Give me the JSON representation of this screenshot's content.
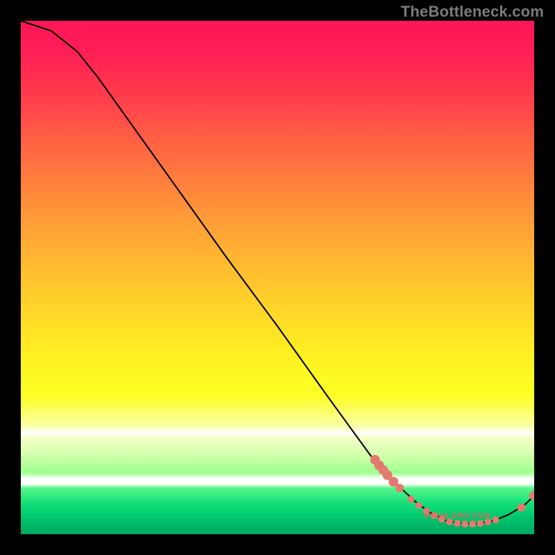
{
  "watermark": "TheBottleneck.com",
  "inline_label": "NVIDIA GRID K520",
  "colors": {
    "marker": "#e37a6f",
    "curve": "#000000",
    "gradient_top": "#ff1657",
    "gradient_mid": "#fff021",
    "gradient_bottom": "#00a85f"
  },
  "chart_data": {
    "type": "line",
    "title": "",
    "xlabel": "",
    "ylabel": "",
    "xlim": [
      0,
      100
    ],
    "ylim": [
      0,
      100
    ],
    "curve": [
      {
        "x": 0,
        "y": 100
      },
      {
        "x": 6,
        "y": 98
      },
      {
        "x": 11,
        "y": 94
      },
      {
        "x": 15,
        "y": 89
      },
      {
        "x": 20,
        "y": 82
      },
      {
        "x": 30,
        "y": 68
      },
      {
        "x": 40,
        "y": 54
      },
      {
        "x": 50,
        "y": 40.5
      },
      {
        "x": 60,
        "y": 26.5
      },
      {
        "x": 68,
        "y": 15.5
      },
      {
        "x": 71,
        "y": 12
      },
      {
        "x": 74,
        "y": 9
      },
      {
        "x": 77,
        "y": 6.2
      },
      {
        "x": 80,
        "y": 4
      },
      {
        "x": 83,
        "y": 2.6
      },
      {
        "x": 86,
        "y": 2.1
      },
      {
        "x": 89,
        "y": 2.1
      },
      {
        "x": 92,
        "y": 2.6
      },
      {
        "x": 95,
        "y": 3.8
      },
      {
        "x": 98,
        "y": 5.6
      },
      {
        "x": 100,
        "y": 7.5
      }
    ],
    "markers": [
      {
        "x": 69.0,
        "y": 14.5,
        "r": 7
      },
      {
        "x": 69.8,
        "y": 13.4,
        "r": 7
      },
      {
        "x": 70.6,
        "y": 12.5,
        "r": 7
      },
      {
        "x": 71.4,
        "y": 11.5,
        "r": 7
      },
      {
        "x": 72.6,
        "y": 10.2,
        "r": 7
      },
      {
        "x": 73.8,
        "y": 9.0,
        "r": 6
      },
      {
        "x": 76.0,
        "y": 6.8,
        "r": 5
      },
      {
        "x": 77.5,
        "y": 5.6,
        "r": 5
      },
      {
        "x": 79.0,
        "y": 4.5,
        "r": 5
      },
      {
        "x": 80.5,
        "y": 3.6,
        "r": 5
      },
      {
        "x": 82.0,
        "y": 2.9,
        "r": 5
      },
      {
        "x": 83.5,
        "y": 2.4,
        "r": 5
      },
      {
        "x": 85.0,
        "y": 2.1,
        "r": 5
      },
      {
        "x": 86.5,
        "y": 2.0,
        "r": 5
      },
      {
        "x": 88.0,
        "y": 2.0,
        "r": 5
      },
      {
        "x": 89.5,
        "y": 2.1,
        "r": 5
      },
      {
        "x": 91.0,
        "y": 2.4,
        "r": 5
      },
      {
        "x": 92.5,
        "y": 2.8,
        "r": 5
      },
      {
        "x": 97.5,
        "y": 5.2,
        "r": 6
      },
      {
        "x": 100.0,
        "y": 7.5,
        "r": 7
      }
    ],
    "inline_label_position": {
      "x": 85.0,
      "y": 3.5
    }
  }
}
